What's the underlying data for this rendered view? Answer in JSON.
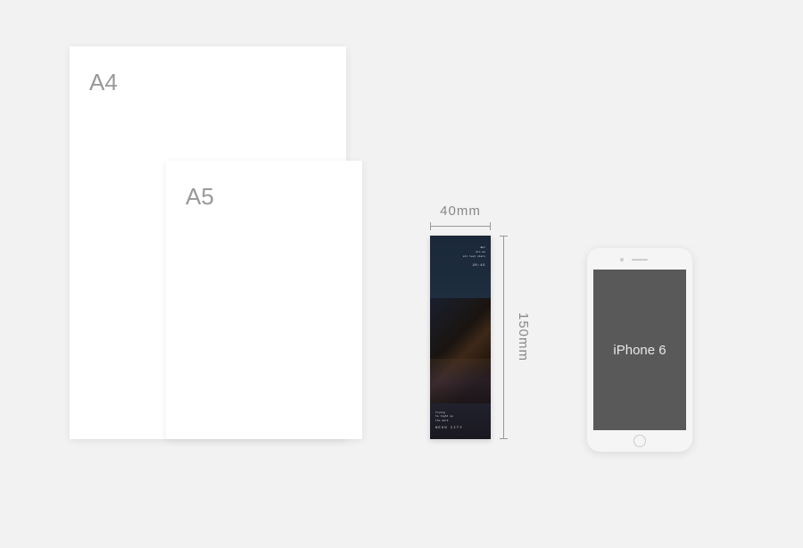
{
  "paper": {
    "a4_label": "A4",
    "a5_label": "A5"
  },
  "dimensions": {
    "width_label": "40mm",
    "height_label": "150mm"
  },
  "bookmark": {
    "top_line1": "But",
    "top_line2": "are we",
    "top_line3": "all lost stars",
    "time": "20:45",
    "bottom_line1": "Trying",
    "bottom_line2": "to light up",
    "bottom_line3": "the dark",
    "title": "NEON CITY"
  },
  "phone": {
    "model_label": "iPhone 6"
  }
}
